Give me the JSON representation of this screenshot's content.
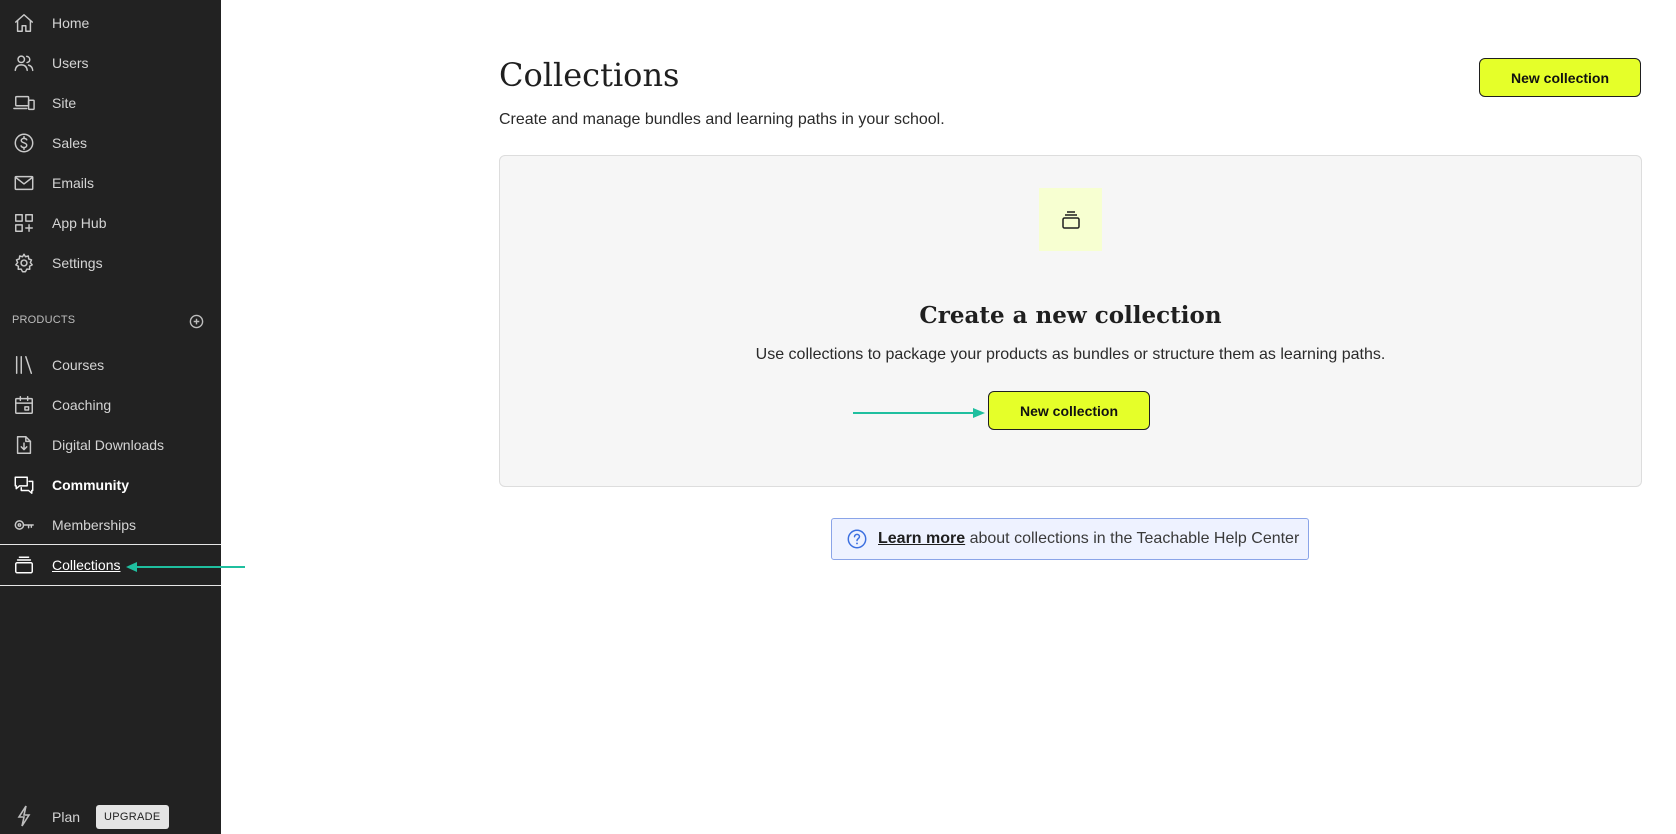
{
  "sidebar": {
    "items": [
      {
        "label": "Home",
        "icon": "home-icon"
      },
      {
        "label": "Users",
        "icon": "users-icon"
      },
      {
        "label": "Site",
        "icon": "devices-icon"
      },
      {
        "label": "Sales",
        "icon": "dollar-icon"
      },
      {
        "label": "Emails",
        "icon": "mail-icon"
      },
      {
        "label": "App Hub",
        "icon": "apps-icon"
      },
      {
        "label": "Settings",
        "icon": "gear-icon"
      }
    ],
    "products_header": "PRODUCTS",
    "products": [
      {
        "label": "Courses",
        "icon": "library-icon"
      },
      {
        "label": "Coaching",
        "icon": "calendar-icon"
      },
      {
        "label": "Digital Downloads",
        "icon": "file-download-icon"
      },
      {
        "label": "Community",
        "icon": "chat-icon"
      },
      {
        "label": "Memberships",
        "icon": "key-icon"
      },
      {
        "label": "Collections",
        "icon": "stack-icon"
      }
    ],
    "plan_label": "Plan",
    "upgrade_label": "UPGRADE"
  },
  "main": {
    "title": "Collections",
    "subtitle": "Create and manage bundles and learning paths in your school.",
    "header_button": "New collection",
    "empty_state": {
      "title": "Create a new collection",
      "description": "Use collections to package your products as bundles or structure them as learning paths.",
      "button": "New collection"
    },
    "help": {
      "link": "Learn more",
      "text": " about collections in the Teachable Help Center"
    }
  },
  "colors": {
    "sidebar_bg": "#222222",
    "accent": "#e5ff29",
    "annotation_arrow": "#1fbf9f",
    "help_bg": "#eef2ff"
  }
}
